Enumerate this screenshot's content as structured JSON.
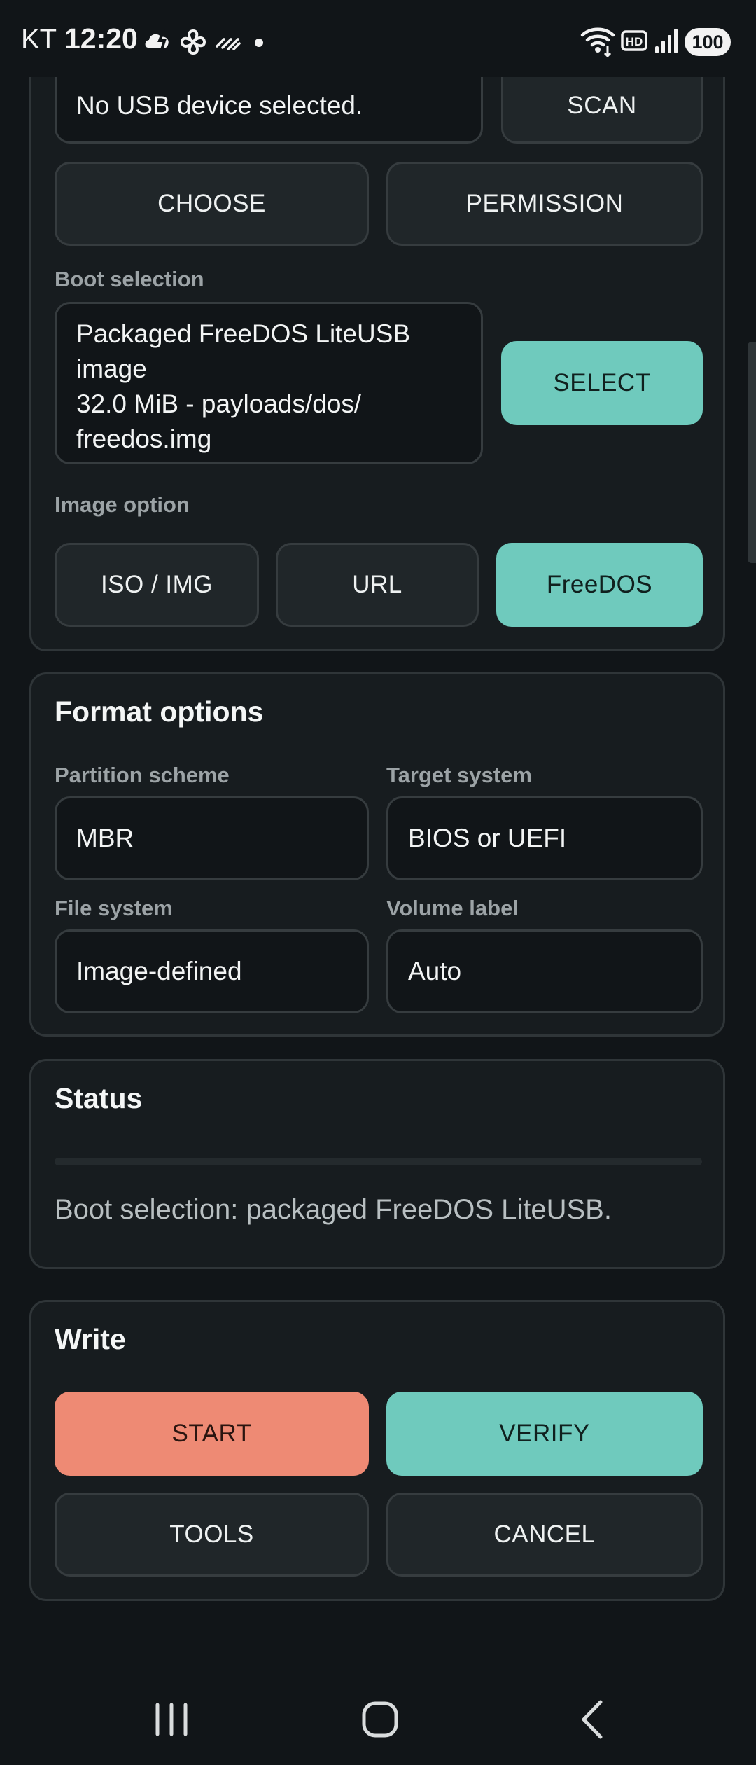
{
  "status_bar": {
    "carrier": "KT",
    "time": "12:20",
    "battery": "100",
    "icons": [
      "weather-cloud-icon",
      "fan-icon",
      "data-saver-icon",
      "notification-dot",
      "wifi-icon",
      "hd-voice-icon",
      "signal-icon",
      "battery-icon"
    ]
  },
  "device": {
    "device_field": "No USB device selected.",
    "scan_button": "SCAN",
    "choose_button": "CHOOSE",
    "permission_button": "PERMISSION"
  },
  "boot": {
    "label": "Boot selection",
    "value": "Packaged FreeDOS LiteUSB\nimage\n32.0 MiB - payloads/dos/\nfreedos.img",
    "select_button": "SELECT"
  },
  "image_option": {
    "label": "Image option",
    "options": [
      "ISO / IMG",
      "URL",
      "FreeDOS"
    ],
    "selected": "FreeDOS"
  },
  "format": {
    "title": "Format options",
    "partition_label": "Partition scheme",
    "partition_value": "MBR",
    "target_label": "Target system",
    "target_value": "BIOS or UEFI",
    "filesystem_label": "File system",
    "filesystem_value": "Image-defined",
    "volume_label": "Volume label",
    "volume_value": "Auto"
  },
  "status": {
    "title": "Status",
    "progress": 0,
    "message": "Boot selection: packaged FreeDOS LiteUSB."
  },
  "write": {
    "title": "Write",
    "start_button": "START",
    "verify_button": "VERIFY",
    "tools_button": "TOOLS",
    "cancel_button": "CANCEL"
  },
  "colors": {
    "background": "#111518",
    "card": "#171c1f",
    "accent_teal": "#6fcabd",
    "accent_salmon": "#ee8a74",
    "label_gray": "#9ca3a6"
  },
  "nav_bar": {
    "icons": [
      "recents-icon",
      "home-icon",
      "back-icon"
    ]
  }
}
